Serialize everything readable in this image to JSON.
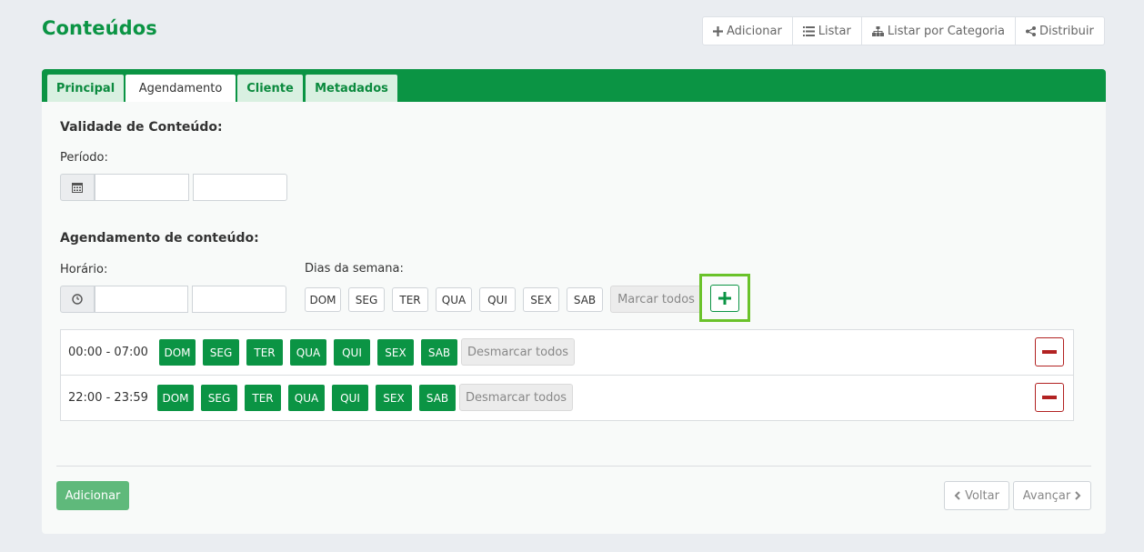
{
  "header": {
    "title": "Conteúdos",
    "actions": [
      {
        "label": "Adicionar",
        "icon": "plus-icon"
      },
      {
        "label": "Listar",
        "icon": "list-icon"
      },
      {
        "label": "Listar por Categoria",
        "icon": "sitemap-icon"
      },
      {
        "label": "Distribuir",
        "icon": "share-icon"
      }
    ]
  },
  "tabs": [
    {
      "label": "Principal",
      "active": false
    },
    {
      "label": "Agendamento",
      "active": true
    },
    {
      "label": "Cliente",
      "active": false
    },
    {
      "label": "Metadados",
      "active": false
    }
  ],
  "validity": {
    "title": "Validade de Conteúdo:",
    "period_label": "Período:",
    "start_value": "",
    "end_value": ""
  },
  "scheduling": {
    "title": "Agendamento de conteúdo:",
    "time_label": "Horário:",
    "start_time": "",
    "end_time": "",
    "days_label": "Dias da semana:",
    "days": [
      "DOM",
      "SEG",
      "TER",
      "QUA",
      "QUI",
      "SEX",
      "SAB"
    ],
    "mark_all_label": "Marcar todos"
  },
  "schedule_rows": [
    {
      "time": "00:00 - 07:00",
      "days": [
        "DOM",
        "SEG",
        "TER",
        "QUA",
        "QUI",
        "SEX",
        "SAB"
      ],
      "unmark_label": "Desmarcar todos"
    },
    {
      "time": "22:00 - 23:59",
      "days": [
        "DOM",
        "SEG",
        "TER",
        "QUA",
        "QUI",
        "SEX",
        "SAB"
      ],
      "unmark_label": "Desmarcar todos"
    }
  ],
  "footer": {
    "add_label": "Adicionar",
    "back_label": "Voltar",
    "next_label": "Avançar"
  },
  "colors": {
    "brand_green": "#0b9444",
    "highlight": "#6ac22a",
    "danger": "#b22222"
  }
}
